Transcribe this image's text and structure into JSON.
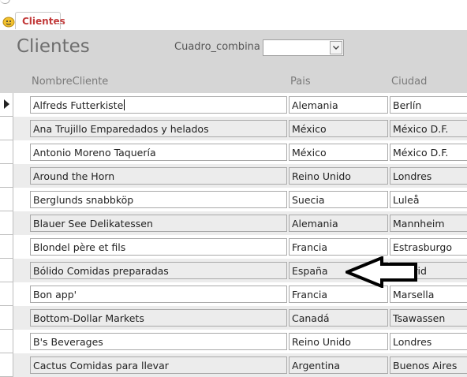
{
  "tab": {
    "label": "Clientes"
  },
  "form": {
    "title": "Clientes",
    "combo_label": "Cuadro_combina",
    "combo_value": ""
  },
  "columns": [
    "NombreCliente",
    "Pais",
    "Ciudad"
  ],
  "rows": [
    [
      "Alfreds Futterkiste",
      "Alemania",
      "Berlín"
    ],
    [
      "Ana Trujillo Emparedados y helados",
      "México",
      "México D.F."
    ],
    [
      "Antonio Moreno Taquería",
      "México",
      "México D.F."
    ],
    [
      "Around the Horn",
      "Reino Unido",
      "Londres"
    ],
    [
      "Berglunds snabbköp",
      "Suecia",
      "Luleå"
    ],
    [
      "Blauer See Delikatessen",
      "Alemania",
      "Mannheim"
    ],
    [
      "Blondel père et fils",
      "Francia",
      "Estrasburgo"
    ],
    [
      "Bólido Comidas preparadas",
      "España",
      "Madrid"
    ],
    [
      "Bon app'",
      "Francia",
      "Marsella"
    ],
    [
      "Bottom-Dollar Markets",
      "Canadá",
      "Tsawassen"
    ],
    [
      "B's Beverages",
      "Reino Unido",
      "Londres"
    ],
    [
      "Cactus Comidas para llevar",
      "Argentina",
      "Buenos Aires"
    ]
  ],
  "icons": {
    "tab": "form-icon",
    "combo": "chevron-down-icon",
    "record": "current-record-icon",
    "annotation": "left-arrow-icon"
  }
}
